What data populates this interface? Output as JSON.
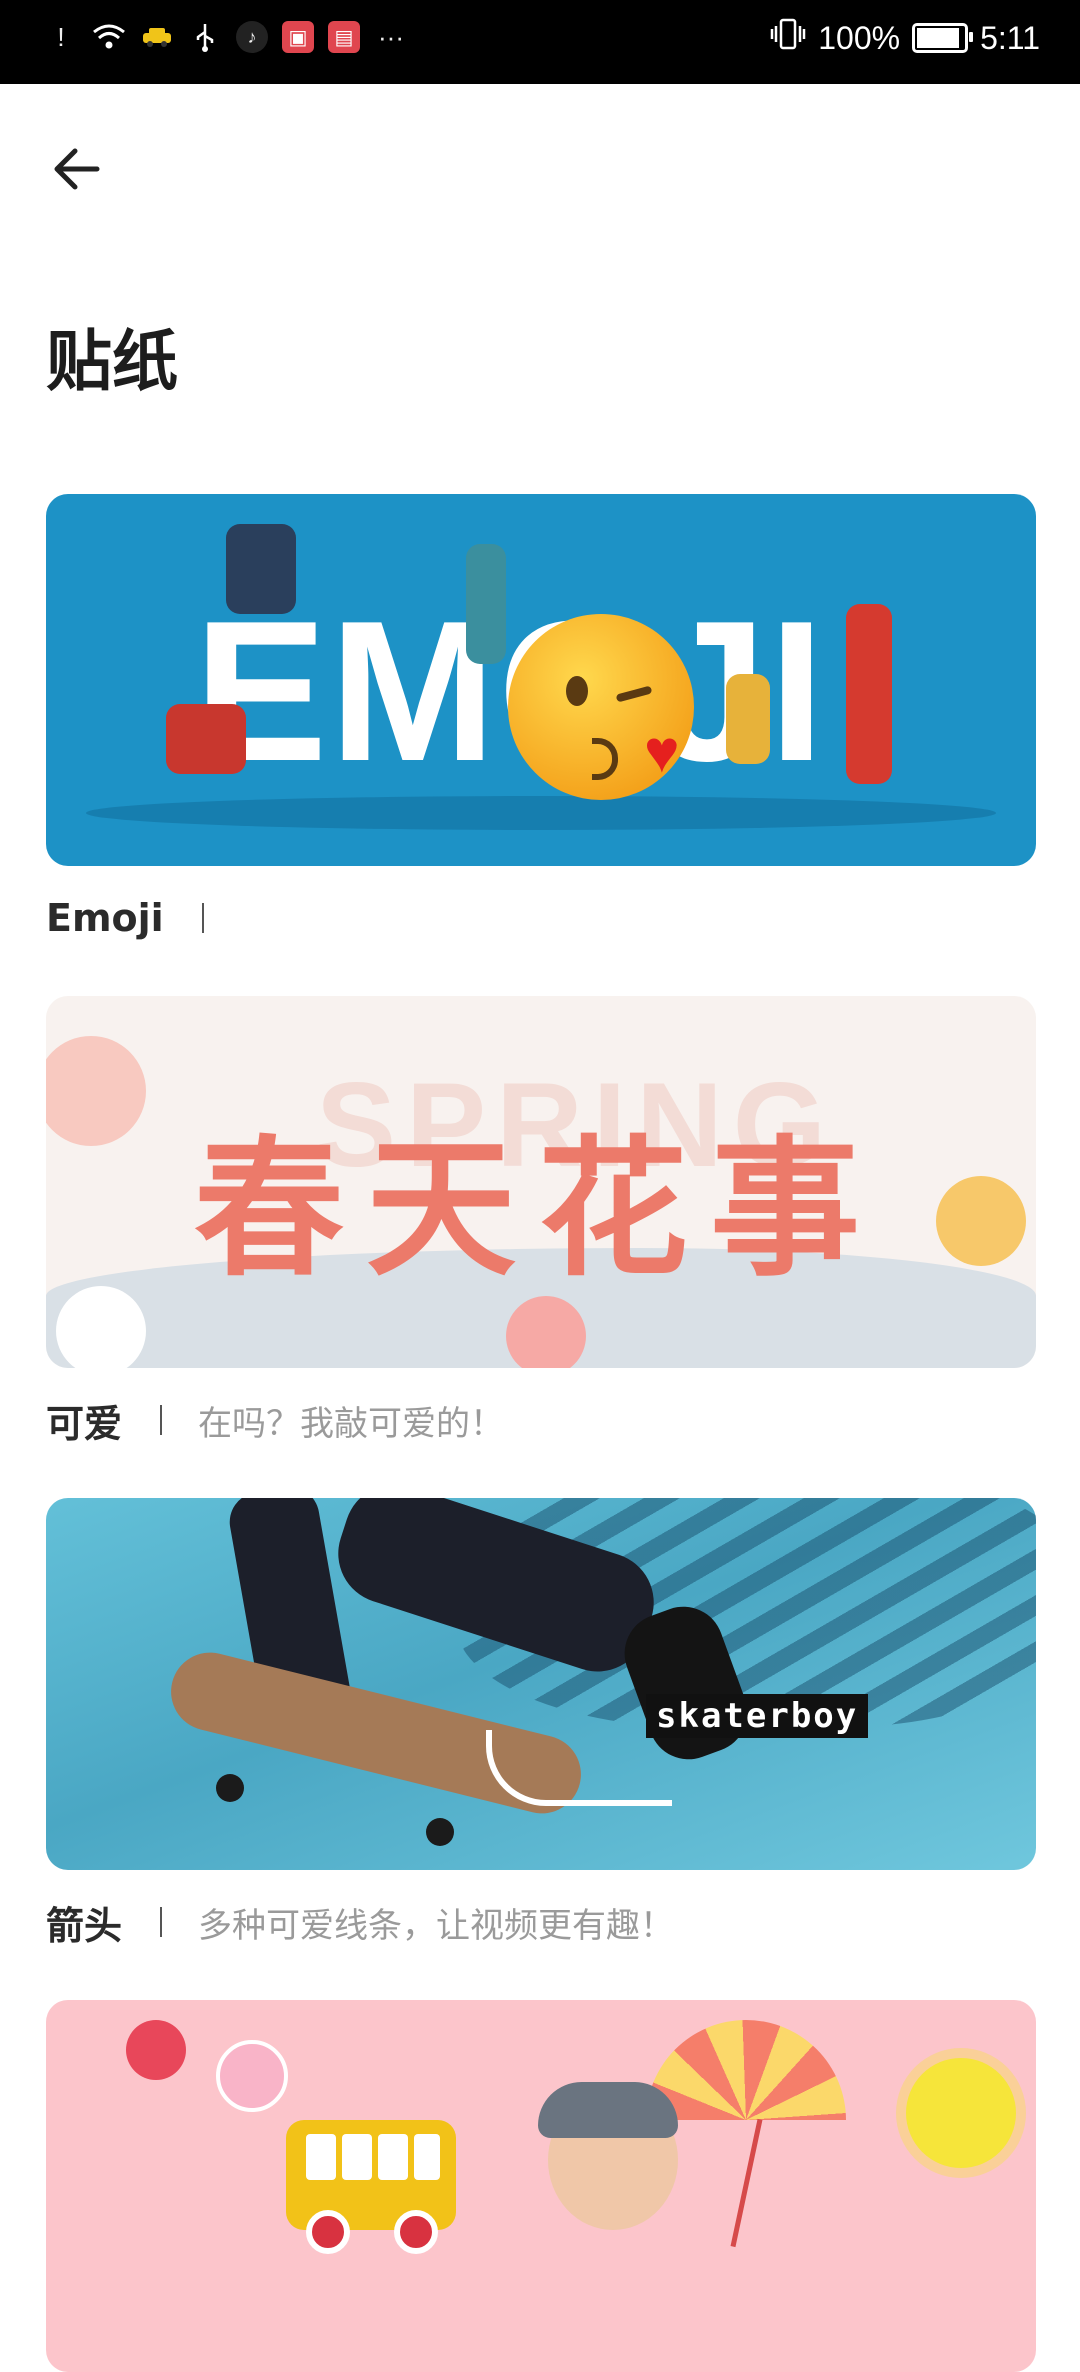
{
  "status_bar": {
    "battery": "100%",
    "time": "5:11",
    "battery_level": 1.0,
    "left_icons": [
      "alert-icon",
      "wifi-icon",
      "taxi-app-icon",
      "usb-icon",
      "tiktok-icon",
      "shopping-app-icon",
      "book-app-icon",
      "more-icon"
    ],
    "more": "···"
  },
  "header": {
    "back_icon": "arrow-left-icon",
    "title": "贴纸"
  },
  "cards": [
    {
      "name": "Emoji",
      "desc": "",
      "banner_word": "EMOJI"
    },
    {
      "name": "可爱",
      "desc": "在吗？我敲可爱的！",
      "banner_title": "春天花事",
      "banner_ghost": "SPRING"
    },
    {
      "name": "箭头",
      "desc": "多种可爱线条，让视频更有趣！",
      "banner_label": "skaterboy"
    },
    {
      "name": "",
      "desc": ""
    }
  ],
  "colors": {
    "emoji_bg": "#1d92c6",
    "spring_title": "#ec7a6a",
    "skate_bg": "#4aa7c4",
    "kids_bg": "#fcc5cb"
  }
}
